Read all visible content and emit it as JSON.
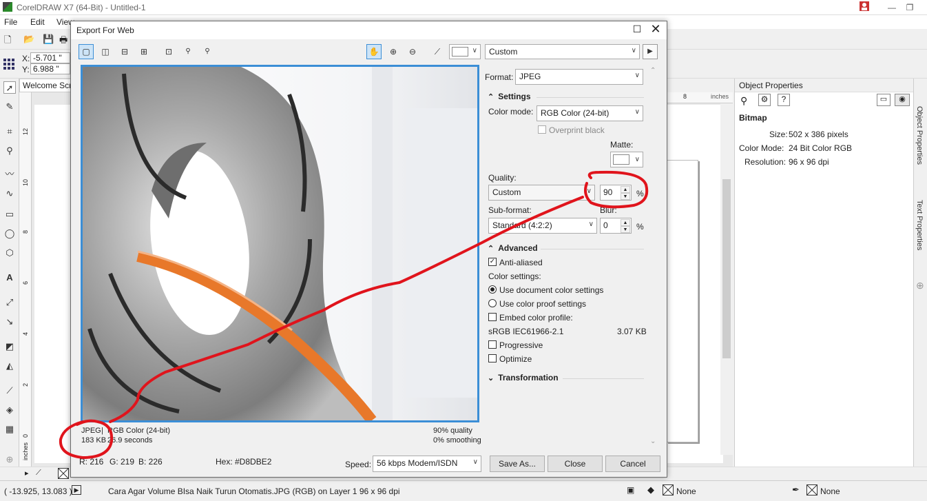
{
  "app": {
    "title": "CorelDRAW X7 (64-Bit) - Untitled-1",
    "menu": [
      "File",
      "Edit",
      "View"
    ],
    "x_label": "X:",
    "x_value": "-5.701 \"",
    "y_label": "Y:",
    "y_value": "6.988 \"",
    "doc_tab": "Welcome Scr",
    "ruler_unit": "inches",
    "ruler_tick_8": "8",
    "vruler_ticks": [
      "12",
      "10",
      "8",
      "6",
      "4",
      "2",
      "0"
    ],
    "vruler_unit": "inches"
  },
  "docker": {
    "title": "Object Properties",
    "section": "Bitmap",
    "size_label": "Size:",
    "size_value": "502 x 386 pixels",
    "colormode_label": "Color Mode:",
    "colormode_value": "24 Bit Color  RGB",
    "resolution_label": "Resolution:",
    "resolution_value": "96 x 96 dpi",
    "vtab1": "Object Properties",
    "vtab2": "Text Properties"
  },
  "status": {
    "coords": "( -13.925, 13.083 )",
    "message": "Cara Agar Volume BIsa Naik Turun Otomatis.JPG (RGB) on Layer 1 96 x 96 dpi",
    "fill_none": "None",
    "outline_none": "None"
  },
  "dialog": {
    "title": "Export For Web",
    "preset": "Custom",
    "format_label": "Format:",
    "format_value": "JPEG",
    "settings_header": "Settings",
    "color_mode_label": "Color mode:",
    "color_mode_value": "RGB Color (24-bit)",
    "overprint_label": "Overprint black",
    "matte_label": "Matte:",
    "quality_label": "Quality:",
    "quality_preset": "Custom",
    "quality_value": "90",
    "percent": "%",
    "subformat_label": "Sub-format:",
    "blur_label": "Blur:",
    "subformat_value": "Standard (4:2:2)",
    "blur_value": "0",
    "advanced_header": "Advanced",
    "antialiased_label": "Anti-aliased",
    "color_settings_label": "Color settings:",
    "use_document_label": "Use document color settings",
    "use_proof_label": "Use color proof settings",
    "embed_profile_label": "Embed color profile:",
    "profile_name": "sRGB IEC61966-2.1",
    "profile_size": "3.07 KB",
    "progressive_label": "Progressive",
    "optimize_label": "Optimize",
    "transformation_header": "Transformation",
    "info_format": "JPEG",
    "info_sep": "|",
    "info_colormode": "RGB Color (24-bit)",
    "info_size": "183 KB",
    "info_time": "26.9 seconds",
    "info_quality": "90% quality",
    "info_smoothing": "0% smoothing",
    "rgb_r": "R: 216",
    "rgb_g": "G: 219",
    "rgb_b": "B: 226",
    "hex": "Hex: #D8DBE2",
    "speed_label": "Speed:",
    "speed_value": "56 kbps Modem/ISDN",
    "save_as": "Save As...",
    "close": "Close",
    "cancel": "Cancel"
  },
  "colors": {
    "accent": "#3b8ed6",
    "annotation": "#e0141c",
    "cable": "#e8782a"
  }
}
